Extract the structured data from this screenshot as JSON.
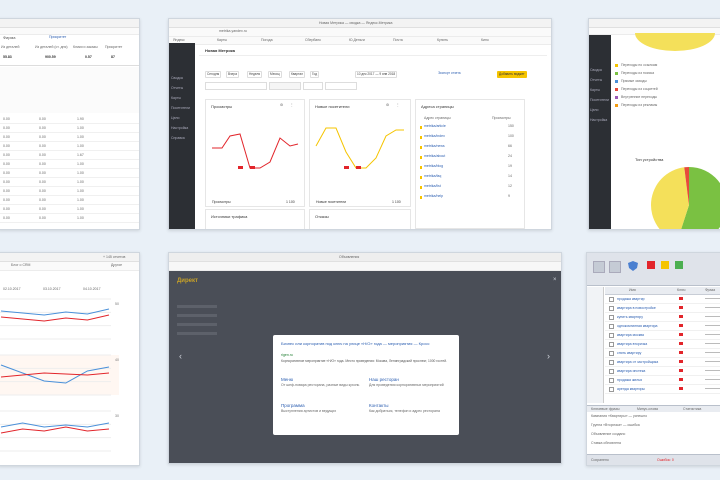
{
  "card1": {
    "nav_label": "Приоритет",
    "filter_label": "Фирма",
    "head_cols": [
      "Из деталей",
      "Из деталей (ст. дня)",
      "Клики и заказы",
      "Приоритет"
    ],
    "top_vals": [
      "55.83",
      "900.59",
      "0.57",
      "87"
    ],
    "rows": [
      [
        "0.00",
        "0.00",
        "1.90"
      ],
      [
        "0.00",
        "0.00",
        "1.00"
      ],
      [
        "0.00",
        "0.00",
        "1.00"
      ],
      [
        "0.00",
        "0.00",
        "1.00"
      ],
      [
        "0.00",
        "0.00",
        "1.67"
      ],
      [
        "0.00",
        "0.00",
        "1.00"
      ],
      [
        "0.00",
        "0.00",
        "1.00"
      ],
      [
        "0.00",
        "0.00",
        "1.00"
      ],
      [
        "0.00",
        "0.00",
        "1.00"
      ],
      [
        "0.00",
        "0.00",
        "1.00"
      ],
      [
        "0.00",
        "0.00",
        "1.00"
      ],
      [
        "0.00",
        "0.00",
        "1.00"
      ]
    ]
  },
  "card2": {
    "title": "Новая Метрика — сводка — Яндекс.Метрика",
    "url": "metrika.yandex.ru",
    "bookmarks": [
      "Яндекс",
      "Карты",
      "Погода",
      "Сбербанк",
      "Ю.Деньги",
      "Почта",
      "Купить",
      "Кино"
    ],
    "site_label": "Новая Метрика",
    "tabs": [
      "Сегодня",
      "Вчера",
      "Неделя",
      "Месяц",
      "Квартал",
      "Год"
    ],
    "date_range": "10 дек 2017 — 9 янв 2018",
    "export_label": "Экспорт отчета",
    "create_btn": "Добавить виджет",
    "sidebar_items": [
      "Сводка",
      "Отчеты",
      "Карты",
      "Посетители",
      "Цели",
      "Настройка",
      "Справка"
    ],
    "widgets": {
      "w1": {
        "title": "Просмотры",
        "legend": "Просмотры",
        "value": "1 100"
      },
      "w2": {
        "title": "Новые посетители",
        "legend": "Новые посетители",
        "value": "1 100"
      },
      "w3": {
        "title": "Адреса страницы",
        "col1": "Адрес страницы",
        "col2": "Просмотры",
        "rows": [
          [
            "metrika/article",
            "150"
          ],
          [
            "metrika/index",
            "100"
          ],
          [
            "metrika/news",
            "66"
          ],
          [
            "metrika/about",
            "24"
          ],
          [
            "metrika/blog",
            "19"
          ],
          [
            "metrika/faq",
            "14"
          ],
          [
            "metrika/list",
            "12"
          ],
          [
            "metrika/help",
            "9"
          ]
        ]
      },
      "w4": {
        "title": "Источники трафика"
      },
      "w5": {
        "title": "Отказы"
      }
    }
  },
  "card3": {
    "legend": [
      "Переходы по ссылкам",
      "Переходы из поиска",
      "Прямые заходы",
      "Переходы из соцсетей",
      "Внутренние переходы",
      "Переходы из рекламы"
    ],
    "device_title": "Тип устройства",
    "sidebar_items": [
      "Сводка",
      "Отчеты",
      "Карты",
      "Посетители",
      "Цели",
      "Настройка"
    ],
    "pie": [
      {
        "name": "Desktop",
        "value": 55,
        "color": "#7ac142"
      },
      {
        "name": "Mobile",
        "value": 43,
        "color": "#f4e05a"
      },
      {
        "name": "Tablet",
        "value": 2,
        "color": "#e64a3b"
      }
    ]
  },
  "card4": {
    "toolbar_left": "Блог о CRM",
    "toolbar_right": "Другое",
    "dates": [
      "02.10.2017",
      "03.10.2017",
      "04.10.2017"
    ],
    "ytick_labels": [
      "50",
      "40",
      "30",
      "20",
      "10"
    ],
    "chart_data": [
      {
        "type": "line",
        "series": [
          {
            "values": [
              28,
              26,
              24,
              27,
              25,
              30
            ]
          },
          {
            "values": [
              22,
              20,
              18,
              21,
              19,
              24
            ]
          }
        ]
      },
      {
        "type": "line",
        "series": [
          {
            "values": [
              30,
              22,
              14,
              12,
              24,
              28
            ]
          },
          {
            "values": [
              18,
              20,
              22,
              21,
              20,
              22
            ]
          }
        ]
      },
      {
        "type": "line",
        "series": [
          {
            "values": [
              24,
              28,
              24,
              26,
              24,
              28
            ]
          },
          {
            "values": [
              18,
              22,
              20,
              24,
              20,
              22
            ]
          }
        ]
      }
    ]
  },
  "card5": {
    "title": "Объявления",
    "header": "Директ",
    "ad_title": "Бизнес или корпоратив под ключ на улице «Н/О» года — мероприятия — Кросс",
    "ad_url": "rigen.ru",
    "ad_text": "Корпоративное мероприятие «Н/О» года. Место проведения: Москва, Ленинградский проспект, 1000 гостей.",
    "links": [
      {
        "title": "Меню",
        "desc": "От шеф-повара ресторана, разные виды кухонь"
      },
      {
        "title": "Наш ресторан",
        "desc": "Для проведения корпоративных мероприятий"
      },
      {
        "title": "Программа",
        "desc": "Выступления артистов и ведущих"
      },
      {
        "title": "Контакты",
        "desc": "Как добраться, телефон и адрес ресторана"
      }
    ]
  },
  "card6": {
    "col_headers": [
      "Имя",
      "Ключ",
      "Фраза"
    ],
    "rows": [
      "продажа квартир",
      "квартира в новостройке",
      "купить квартиру",
      "однокомнатная квартира",
      "квартира москва",
      "квартира вторичка",
      "снять квартиру",
      "квартира от застройщика",
      "квартира ипотека",
      "продажа жилья",
      "аренда квартиры"
    ],
    "tabs": [
      "Ключевые фразы",
      "Минус-слова",
      "Статистика"
    ],
    "log_rows": [
      "Кампания «Квартиры» — успешно",
      "Группа «Вторичка» — ошибка",
      "Объявление создано",
      "Ставка обновлена"
    ],
    "status": [
      "Сохранено",
      "Ошибок: 0"
    ]
  },
  "colors": {
    "metrika_yellow": "#f5c400",
    "red": "#e2252b",
    "link_blue": "#2a5db0",
    "chart_blue": "#4a90d9"
  }
}
